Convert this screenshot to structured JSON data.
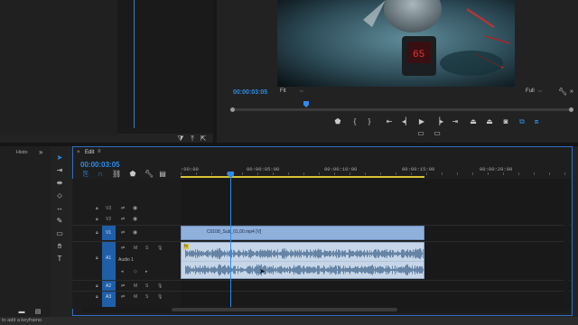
{
  "source_monitor": {},
  "program_monitor": {
    "timecode": "00:00:03:05",
    "fit_label": "Fit",
    "quality_label": "Full",
    "gauge_readout": "65"
  },
  "left_panel": {
    "tab_label": "Histo",
    "expand_label": "»"
  },
  "timeline": {
    "tab_label": "Edit",
    "menu_label": "≡",
    "timecode": "00:00:03:05",
    "ruler_labels": [
      ":00:00",
      "00:00:05:00",
      "00:00:10:00",
      "00:00:15:00",
      "00:00:20:00"
    ],
    "tracks": {
      "v3": "V3",
      "v2": "V2",
      "v1": "V1",
      "a1": "A1",
      "a1_name": "Audio 1",
      "a2": "A2",
      "a3": "A3"
    },
    "video_clip_label": "C0108_Sub_01,00.mp4 [V]",
    "audio_clip_fx": "fx",
    "mute_label": "M",
    "solo_label": "S"
  },
  "status_bar": {
    "text": "to add a keyframe."
  },
  "colors": {
    "accent": "#2d8ceb",
    "video_clip": "#8fb0db",
    "audio_clip": "#c6d6e8",
    "waveform": "#4f6f96"
  }
}
